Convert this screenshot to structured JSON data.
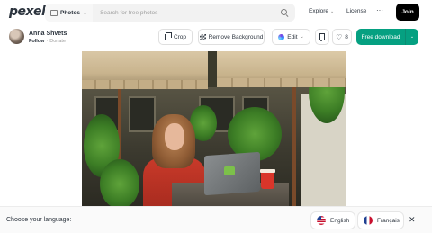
{
  "header": {
    "logo": "pexels",
    "search_type": "Photos",
    "search_placeholder": "Search for free photos",
    "explore": "Explore",
    "license": "License",
    "more": "···",
    "join": "Join"
  },
  "author": {
    "name": "Anna Shvets",
    "follow": "Follow",
    "separator": "·",
    "donate": "Donate"
  },
  "actions": {
    "crop": "Crop",
    "remove_background": "Remove Background",
    "edit": "Edit",
    "likes": "8",
    "download": "Free download"
  },
  "language_bar": {
    "prompt": "Choose your language:",
    "english": "English",
    "french": "Français",
    "close": "✕"
  },
  "colors": {
    "download_green": "#05a081",
    "join_black": "#000000"
  }
}
